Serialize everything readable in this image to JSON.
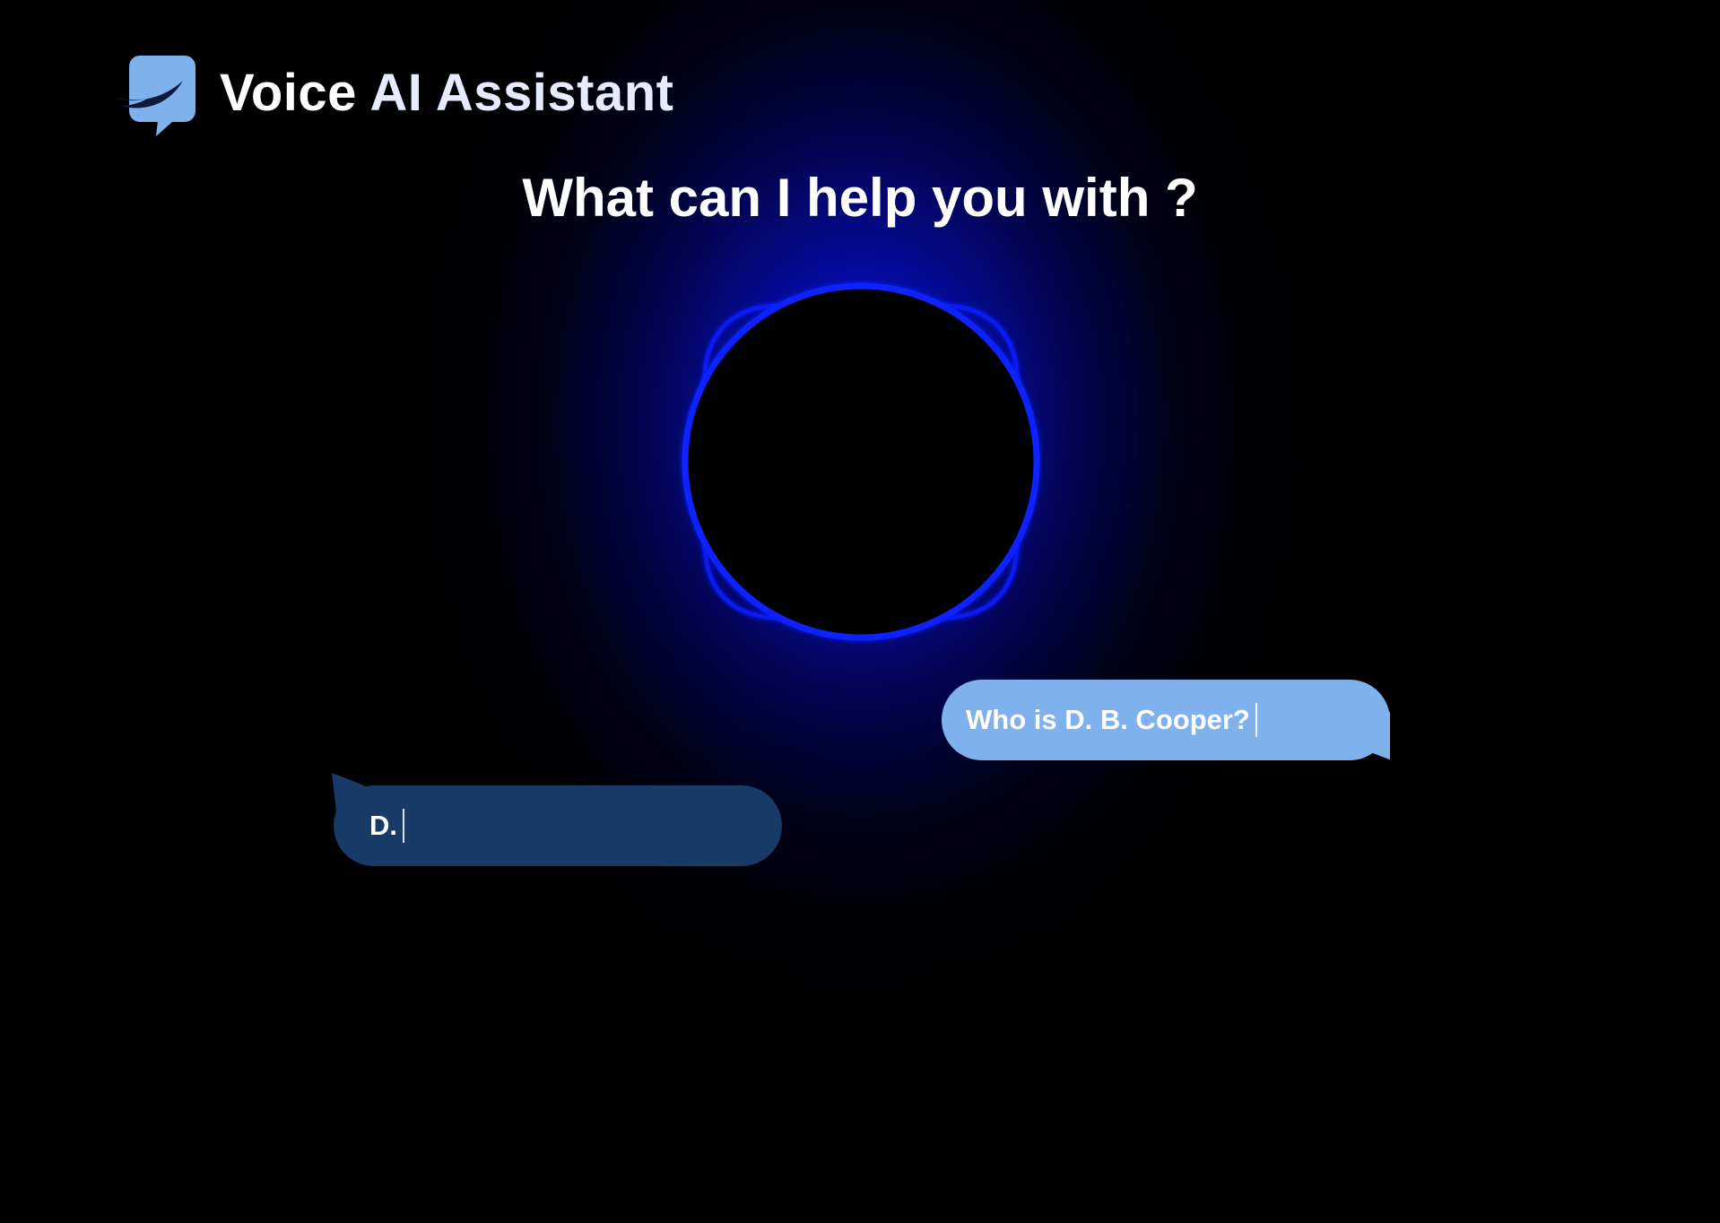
{
  "header": {
    "logo_icon": "chat-bubble-swoosh-icon",
    "title_part1": "Voice ",
    "title_part2": "AI Assistant"
  },
  "prompt": {
    "headline": "What can I help you with ?"
  },
  "orb": {
    "icon": "voice-orb-icon"
  },
  "conversation": {
    "messages": [
      {
        "role": "user",
        "text": "Who is D. B. Cooper?"
      },
      {
        "role": "assistant",
        "text": "D."
      }
    ]
  },
  "colors": {
    "background": "#000000",
    "glow": "#0a14e6",
    "user_bubble": "#7fb1ec",
    "assistant_bubble": "#173a67",
    "logo": "#7fb1ec",
    "orb_ring": "#0b1cff"
  }
}
